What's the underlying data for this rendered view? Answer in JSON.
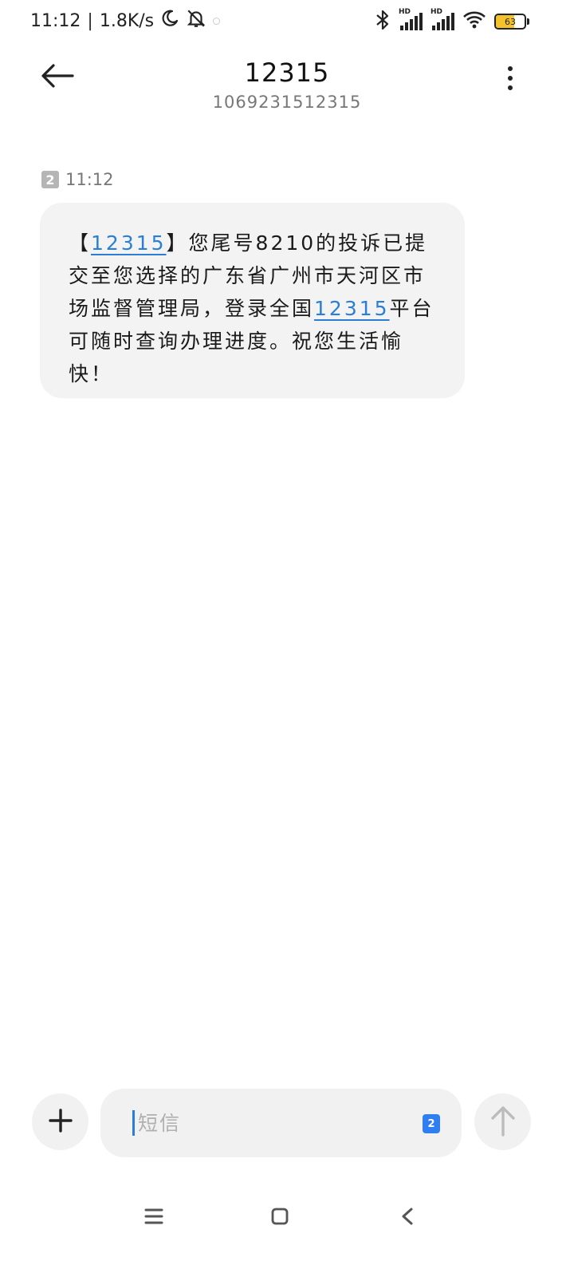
{
  "status_bar": {
    "time": "11:12",
    "network_speed": "1.8K/s",
    "icons": [
      "moon-icon",
      "bell-off-icon",
      "bluetooth-icon",
      "signal-icon",
      "signal-icon",
      "wifi-icon",
      "battery-icon"
    ],
    "sim1_tag": "HD",
    "sim2_tag": "HD",
    "battery_level": "63",
    "battery_color": "#f4c22b"
  },
  "header": {
    "title": "12315",
    "subtitle": "1069231512315",
    "back_icon": "arrow-left-icon",
    "more_icon": "more-vertical-icon"
  },
  "message": {
    "sim_slot": "2",
    "time": "11:12",
    "parts": {
      "p1": "【",
      "link1": "12315",
      "p2": "】您尾号8210的投诉已提交至您选择的广东省广州市天河区市场监督管理局，登录全国",
      "link2": "12315",
      "p3": "平台可随时查询办理进度。祝您生活愉快！"
    },
    "link_color": "#2a7fd4"
  },
  "composer": {
    "add_icon": "plus-icon",
    "placeholder": "短信",
    "sim_slot": "2",
    "sim_color": "#2f7ff0",
    "send_icon": "arrow-up-icon"
  },
  "nav_bar": {
    "icons": [
      "menu-icon",
      "home-icon",
      "back-icon"
    ]
  }
}
